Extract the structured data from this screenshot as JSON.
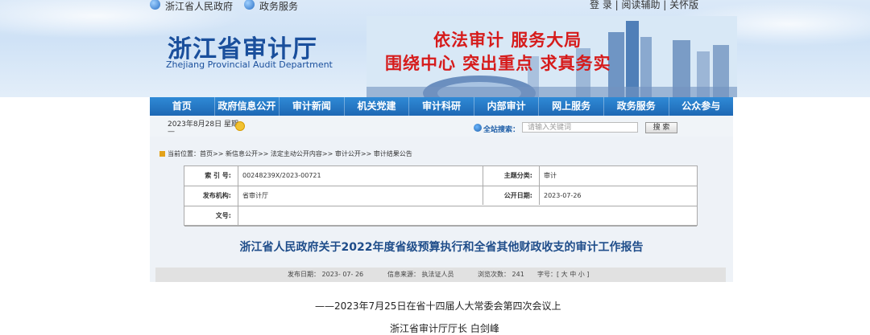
{
  "topbar": {
    "left_links": [
      "浙江省人民政府",
      "政务服务"
    ],
    "right_text": "登 录 | 阅读辅助 | 关怀版"
  },
  "header": {
    "title": "浙江省审计厅",
    "subtitle": "Zhejiang Provincial Audit Department",
    "slogan_line1": "依法审计  服务大局",
    "slogan_line2": "围绕中心  突出重点  求真务实"
  },
  "nav": {
    "items": [
      "首页",
      "政府信息公开",
      "审计新闻",
      "机关党建",
      "审计科研",
      "内部审计",
      "网上服务",
      "政务服务",
      "公众参与"
    ]
  },
  "infobar": {
    "date": "2023年8月28日 星期",
    "date_dash": "—",
    "search_label": "全站搜索：",
    "search_placeholder": "请输入关键词",
    "search_button": "搜 索"
  },
  "breadcrumb": {
    "text": "当前位置：首页>> 新信息公开>> 法定主动公开内容>> 审计公开>> 审计结果公告"
  },
  "meta": {
    "index_label": "索 引 号:",
    "index_value": "00248239X/2023-00721",
    "topic_label": "主题分类:",
    "topic_value": "审计",
    "issuer_label": "发布机构:",
    "issuer_value": "省审计厅",
    "pubdate_label": "公开日期:",
    "pubdate_value": "2023-07-26",
    "docno_label": "文号:",
    "docno_value": ""
  },
  "article": {
    "title": "浙江省人民政府关于2022年度省级预算执行和全省其他财政收支的审计工作报告",
    "info_date": "发布日期：  2023- 07- 26",
    "info_source": "信息来源：  执法证人员",
    "info_views": "浏览次数：  241",
    "info_fontsize": "字号：[ 大 中 小 ]",
    "line1": "——2023年7月25日在省十四届人大常委会第四次会议上",
    "line2": "浙江省审计厅厅长  白剑峰"
  }
}
